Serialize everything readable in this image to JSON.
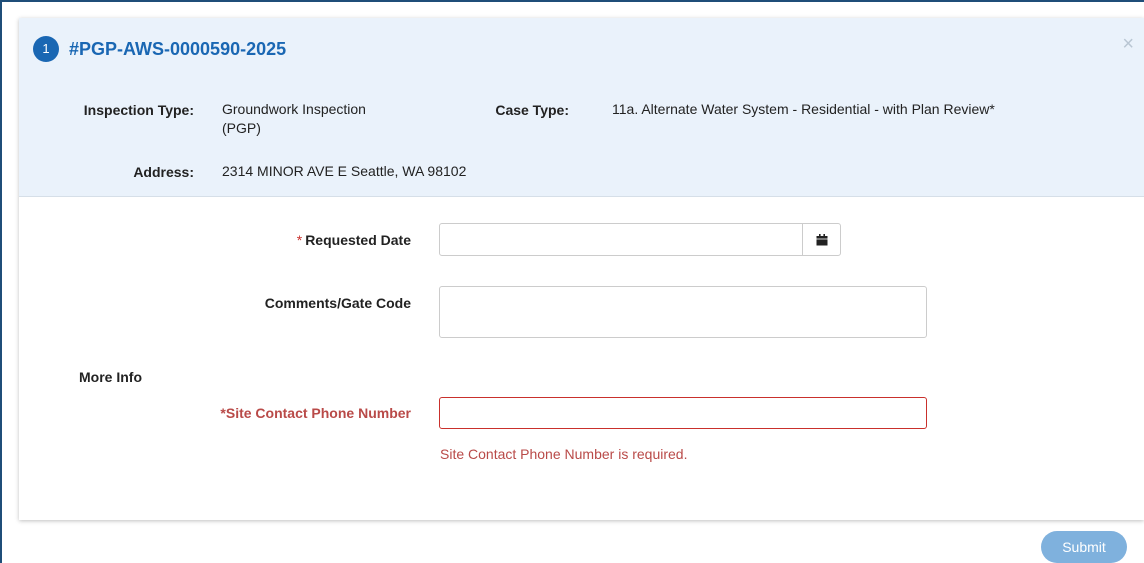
{
  "header": {
    "step_number": "1",
    "case_number": "#PGP-AWS-0000590-2025",
    "close_glyph": "×"
  },
  "info": {
    "inspection_type_label": "Inspection Type:",
    "inspection_type_line1": "Groundwork Inspection",
    "inspection_type_line2": "(PGP)",
    "case_type_label": "Case Type:",
    "case_type_value": "11a. Alternate Water System - Residential - with Plan Review*",
    "address_label": "Address:",
    "address_value": "2314 MINOR AVE E Seattle, WA 98102"
  },
  "form": {
    "requested_date": {
      "required_star": "*",
      "label": "Requested Date",
      "value": "",
      "placeholder": ""
    },
    "comments": {
      "label": "Comments/Gate Code",
      "value": "",
      "placeholder": ""
    },
    "more_info_heading": "More Info",
    "site_contact_phone": {
      "label": "*Site Contact Phone Number",
      "value": "",
      "placeholder": "",
      "error": "Site Contact Phone Number is required."
    }
  },
  "actions": {
    "submit_label": "Submit"
  },
  "colors": {
    "accent": "#1a67b3",
    "header_bg": "#eaf2fb",
    "error": "#b94a48",
    "submit_bg": "#7fb1dd"
  },
  "icons": {
    "calendar": "calendar-icon",
    "close": "close-icon"
  }
}
